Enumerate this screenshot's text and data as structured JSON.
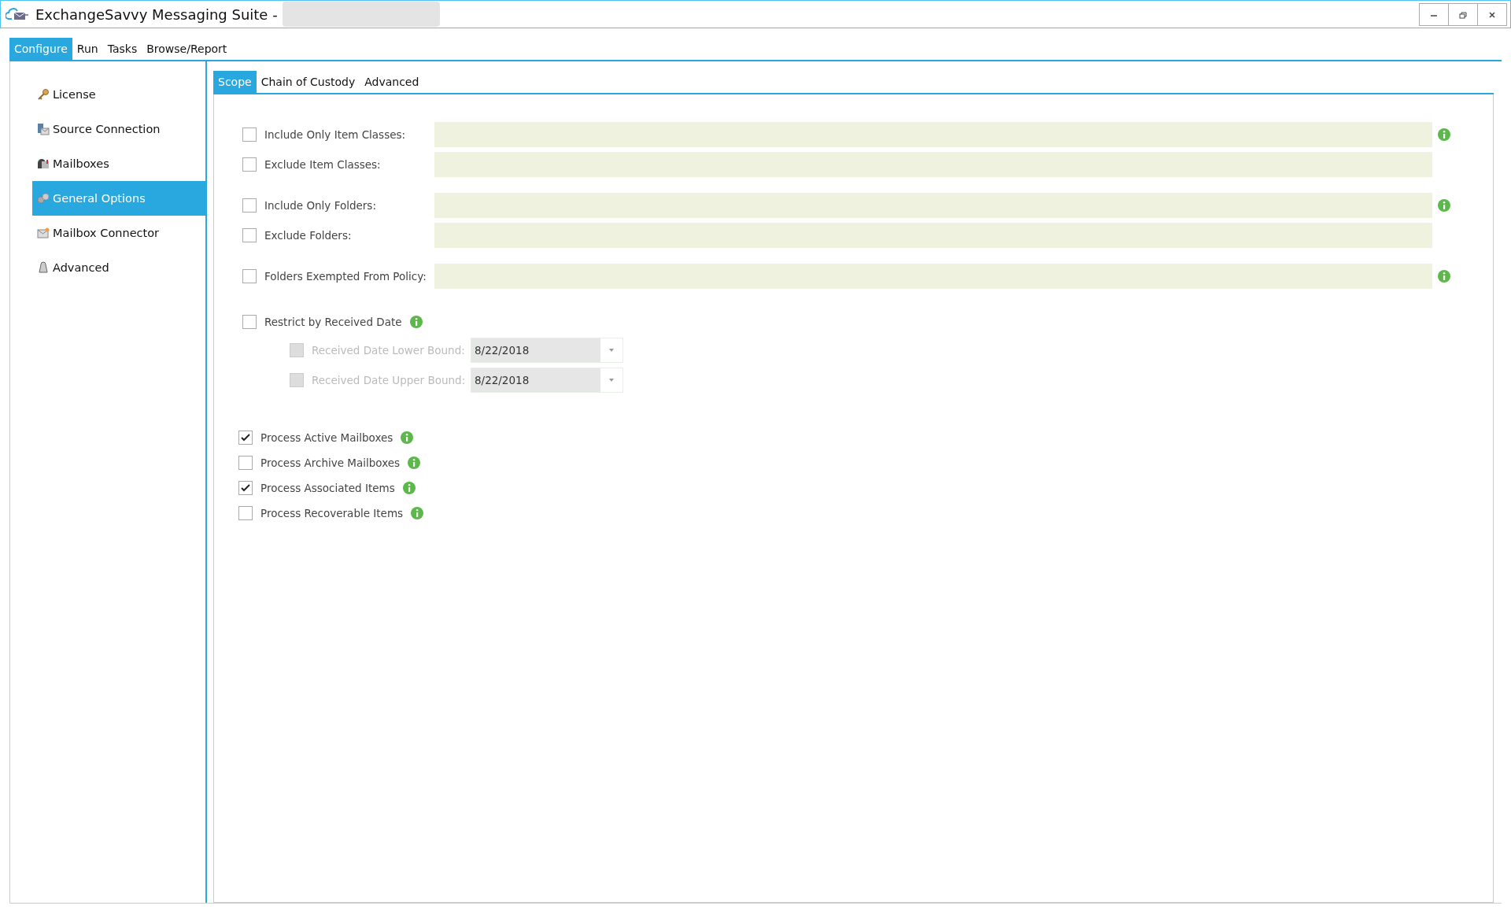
{
  "window": {
    "title": "ExchangeSavvy Messaging Suite -"
  },
  "menu_tabs": [
    {
      "label": "Configure",
      "selected": true
    },
    {
      "label": "Run",
      "selected": false
    },
    {
      "label": "Tasks",
      "selected": false
    },
    {
      "label": "Browse/Report",
      "selected": false
    }
  ],
  "sidebar": {
    "items": [
      {
        "label": "License",
        "selected": false
      },
      {
        "label": "Source Connection",
        "selected": false
      },
      {
        "label": "Mailboxes",
        "selected": false
      },
      {
        "label": "General Options",
        "selected": true
      },
      {
        "label": "Mailbox Connector",
        "selected": false
      },
      {
        "label": "Advanced",
        "selected": false
      }
    ]
  },
  "content_tabs": [
    {
      "label": "Scope",
      "selected": true
    },
    {
      "label": "Chain of Custody",
      "selected": false
    },
    {
      "label": "Advanced",
      "selected": false
    }
  ],
  "filter_groups": [
    [
      {
        "label": "Include Only Item Classes:",
        "checked": false,
        "info": true
      },
      {
        "label": "Exclude Item Classes:",
        "checked": false,
        "info": false
      }
    ],
    [
      {
        "label": "Include Only Folders:",
        "checked": false,
        "info": true
      },
      {
        "label": "Exclude Folders:",
        "checked": false,
        "info": false
      }
    ],
    [
      {
        "label": "Folders Exempted From Policy:",
        "checked": false,
        "info": true
      }
    ]
  ],
  "date_restriction": {
    "label": "Restrict by Received Date",
    "checked": false,
    "info": true,
    "bounds": [
      {
        "label": "Received Date Lower Bound:",
        "checked": false,
        "disabled": true,
        "value": "8/22/2018"
      },
      {
        "label": "Received Date Upper Bound:",
        "checked": false,
        "disabled": true,
        "value": "8/22/2018"
      }
    ]
  },
  "process_options": [
    {
      "label": "Process Active Mailboxes",
      "checked": true,
      "info": true
    },
    {
      "label": "Process Archive Mailboxes",
      "checked": false,
      "info": true
    },
    {
      "label": "Process Associated Items",
      "checked": true,
      "info": true
    },
    {
      "label": "Process Recoverable Items",
      "checked": false,
      "info": true
    }
  ]
}
